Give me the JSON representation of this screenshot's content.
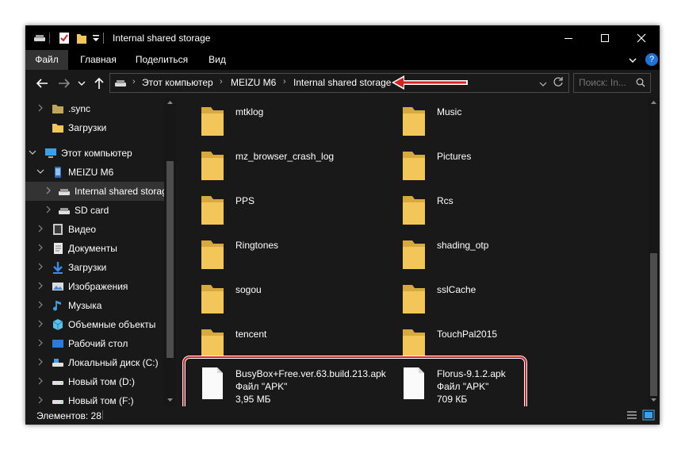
{
  "window": {
    "title": "Internal shared storage",
    "controls": {
      "minimize": "—",
      "maximize": "☐",
      "close": "✕"
    }
  },
  "ribbon": {
    "tabs": [
      {
        "label": "Файл",
        "active": true
      },
      {
        "label": "Главная",
        "active": false
      },
      {
        "label": "Поделиться",
        "active": false
      },
      {
        "label": "Вид",
        "active": false
      }
    ],
    "help": "?"
  },
  "navigation": {
    "back": "←",
    "forward": "→",
    "recent": "˅",
    "up": "↑",
    "breadcrumbs": [
      "Этот компьютер",
      "MEIZU M6",
      "Internal shared storage"
    ],
    "refresh": "↻",
    "search_placeholder": "Поиск: In..."
  },
  "sidebar": {
    "items": [
      {
        "label": ".sync",
        "icon": "folder-icon"
      },
      {
        "label": "Загрузки",
        "icon": "folder-icon"
      },
      {
        "label": "Этот компьютер",
        "icon": "computer-icon"
      },
      {
        "label": "MEIZU M6",
        "icon": "phone-icon"
      },
      {
        "label": "Internal shared storage",
        "icon": "drive-icon",
        "selected": true
      },
      {
        "label": "SD card",
        "icon": "drive-icon"
      },
      {
        "label": "Видео",
        "icon": "video-icon"
      },
      {
        "label": "Документы",
        "icon": "documents-icon"
      },
      {
        "label": "Загрузки",
        "icon": "download-icon"
      },
      {
        "label": "Изображения",
        "icon": "pictures-icon"
      },
      {
        "label": "Музыка",
        "icon": "music-icon"
      },
      {
        "label": "Объемные объекты",
        "icon": "3d-objects-icon"
      },
      {
        "label": "Рабочий стол",
        "icon": "desktop-icon"
      },
      {
        "label": "Локальный диск (C:)",
        "icon": "disk-icon"
      },
      {
        "label": "Новый том (D:)",
        "icon": "disk-icon"
      },
      {
        "label": "Новый том (F:)",
        "icon": "disk-icon"
      }
    ]
  },
  "content": {
    "folders": [
      "mtklog",
      "Music",
      "mz_browser_crash_log",
      "Pictures",
      "PPS",
      "Rcs",
      "Ringtones",
      "shading_otp",
      "sogou",
      "sslCache",
      "tencent",
      "TouchPal2015"
    ],
    "files": [
      {
        "name": "BusyBox+Free.ver.63.build.213.apk",
        "type": "Файл \"APK\"",
        "size": "3,95 МБ"
      },
      {
        "name": "Florus-9.1.2.apk",
        "type": "Файл \"APK\"",
        "size": "709 КБ"
      }
    ]
  },
  "status": {
    "items_count": "Элементов: 28"
  },
  "colors": {
    "background": "#191919",
    "titlebar": "#000000",
    "folder_yellow": "#f3c659",
    "highlight_red": "#d62424"
  }
}
